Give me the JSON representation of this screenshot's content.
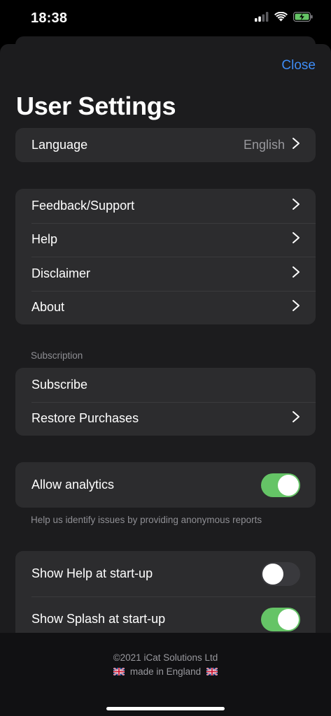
{
  "status_bar": {
    "time": "18:38",
    "icons": [
      "signal-icon",
      "wifi-icon",
      "battery-charging-icon"
    ]
  },
  "header": {
    "close_label": "Close",
    "title": "User Settings"
  },
  "language": {
    "label": "Language",
    "value": "English"
  },
  "info_items": [
    {
      "label": "Feedback/Support"
    },
    {
      "label": "Help"
    },
    {
      "label": "Disclaimer"
    },
    {
      "label": "About"
    }
  ],
  "subscription": {
    "header": "Subscription",
    "items": [
      {
        "label": "Subscribe"
      },
      {
        "label": "Restore Purchases"
      }
    ]
  },
  "analytics": {
    "label": "Allow analytics",
    "enabled": true,
    "footer": "Help us identify issues by providing anonymous reports"
  },
  "startup": {
    "items": [
      {
        "label": "Show Help at start-up",
        "enabled": false
      },
      {
        "label": "Show Splash at start-up",
        "enabled": true
      }
    ]
  },
  "footer": {
    "copyright": "©2021 iCat Solutions Ltd",
    "made_in": "made in England"
  },
  "colors": {
    "accent": "#3e8cf6",
    "toggle_on": "#65c466",
    "cell_background": "#2c2c2e",
    "sheet_background": "#1c1c1e"
  }
}
